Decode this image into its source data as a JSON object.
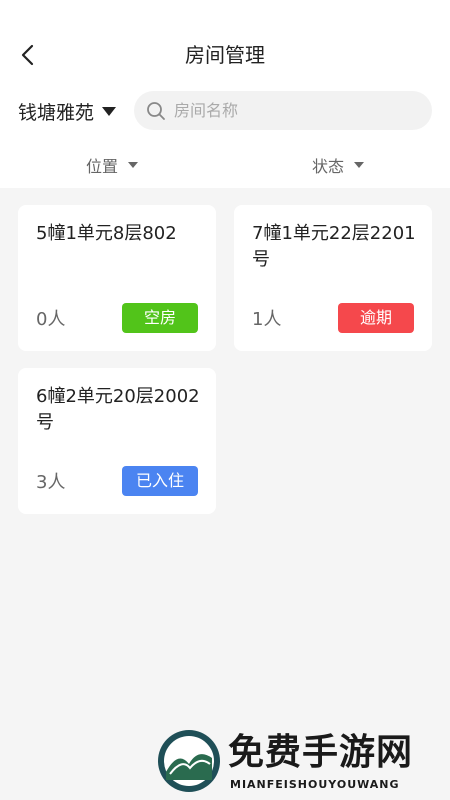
{
  "header": {
    "title": "房间管理",
    "back_icon": "chevron-left-icon"
  },
  "filters": {
    "community": "钱塘雅苑",
    "search_placeholder": "房间名称",
    "position_label": "位置",
    "status_label": "状态"
  },
  "rooms": [
    {
      "name": "5幢1单元8层802",
      "count": "0人",
      "status": "空房",
      "status_color": "#52c41a"
    },
    {
      "name": "7幢1单元22层2201号",
      "count": "1人",
      "status": "逾期",
      "status_color": "#f5484c"
    },
    {
      "name": "6幢2单元20层2002号",
      "count": "3人",
      "status": "已入住",
      "status_color": "#4b84f1"
    }
  ],
  "watermark": {
    "title": "免费手游网",
    "subtitle": "MIANFEISHOUYOUWANG"
  }
}
